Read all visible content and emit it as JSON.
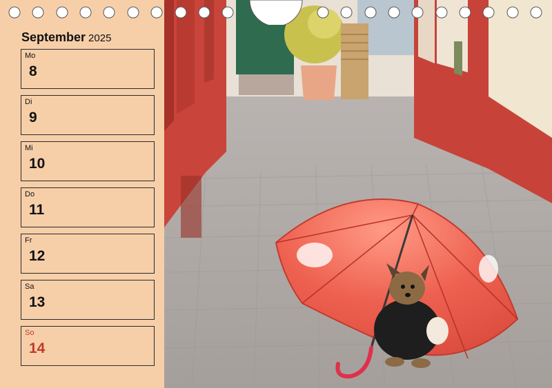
{
  "header": {
    "month": "September",
    "year": "2025"
  },
  "days": [
    {
      "abbr": "Mo",
      "num": "8"
    },
    {
      "abbr": "Di",
      "num": "9"
    },
    {
      "abbr": "Mi",
      "num": "10"
    },
    {
      "abbr": "Do",
      "num": "11"
    },
    {
      "abbr": "Fr",
      "num": "12"
    },
    {
      "abbr": "Sa",
      "num": "13"
    },
    {
      "abbr": "So",
      "num": "14"
    }
  ],
  "colors": {
    "panel": "#f6cfa9",
    "sunday": "#c0392b",
    "umbrella": "#e8574a",
    "walls": "#c9443a"
  },
  "photo": {
    "subject": "yorkshire-terrier-under-umbrella"
  }
}
